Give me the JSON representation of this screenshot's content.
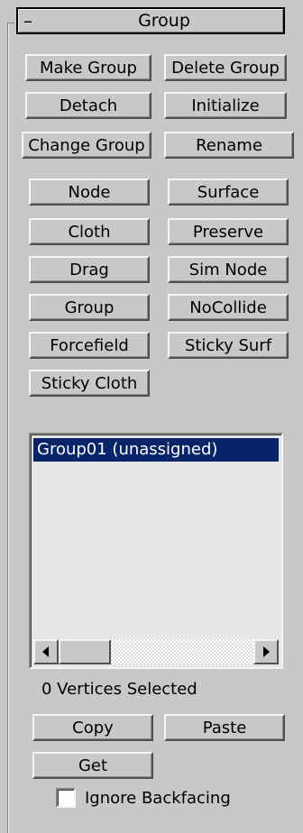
{
  "rollout": {
    "collapse_symbol": "–",
    "title": "Group"
  },
  "buttons": {
    "make_group": "Make Group",
    "delete_group": "Delete Group",
    "detach": "Detach",
    "initialize": "Initialize",
    "change_group": "Change Group",
    "rename": "Rename",
    "node": "Node",
    "surface": "Surface",
    "cloth": "Cloth",
    "preserve": "Preserve",
    "drag": "Drag",
    "sim_node": "Sim Node",
    "group": "Group",
    "nocollide": "NoCollide",
    "forcefield": "Forcefield",
    "sticky_surf": "Sticky Surf",
    "sticky_cloth": "Sticky Cloth",
    "copy": "Copy",
    "paste": "Paste",
    "get": "Get"
  },
  "group_list": {
    "items": [
      "Group01 (unassigned)"
    ],
    "selected_index": 0
  },
  "status_text": "0 Vertices Selected",
  "ignore_backfacing": {
    "label": "Ignore Backfacing",
    "checked": false
  },
  "colors": {
    "panel_bg": "#c8c8c8",
    "selection_bg": "#0a246a",
    "selection_text": "#ffffff",
    "list_bg": "#e6e6e6"
  }
}
